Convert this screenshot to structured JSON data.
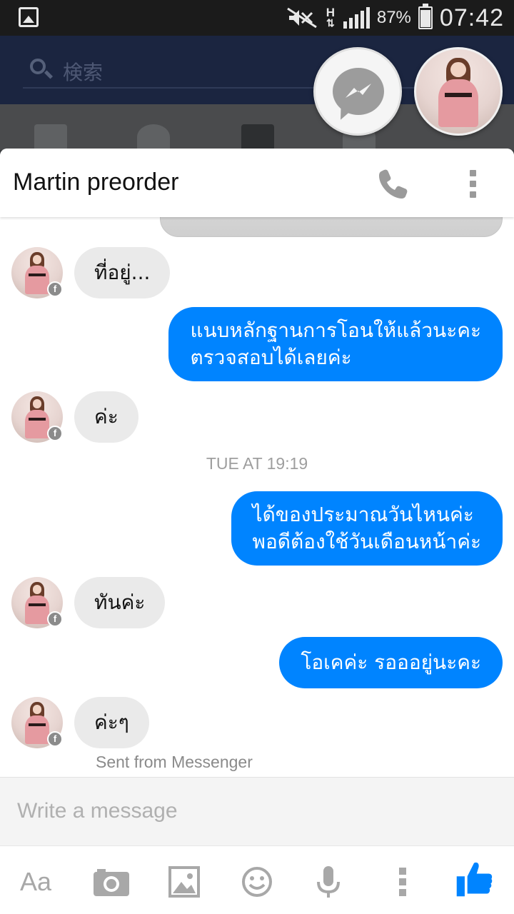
{
  "status_bar": {
    "battery": "87%",
    "time": "07:42",
    "network": "H",
    "icons": [
      "gallery-icon",
      "mute-icon",
      "network-h-icon",
      "signal-icon",
      "battery-icon"
    ]
  },
  "background_app": {
    "search_placeholder": "検索"
  },
  "chat_heads": [
    "messenger-icon",
    "contact-avatar"
  ],
  "conversation": {
    "title": "Martin preorder",
    "actions": [
      "phone-icon",
      "more-icon"
    ],
    "messages": [
      {
        "side": "in",
        "text": "ที่อยู่..."
      },
      {
        "side": "out",
        "lines": [
          "แนบหลักฐานการโอนให้แล้วนะคะ",
          "ตรวจสอบได้เลยค่ะ"
        ]
      },
      {
        "side": "in",
        "text": "ค่ะ"
      },
      {
        "timestamp": "TUE AT 19:19"
      },
      {
        "side": "out",
        "lines": [
          "ได้ของประมาณวันไหนค่ะ",
          "พอดีต้องใช้วันเดือนหน้าค่ะ"
        ]
      },
      {
        "side": "in",
        "text": "ทันค่ะ"
      },
      {
        "side": "out",
        "text": "โอเคค่ะ รอออยู่นะคะ"
      },
      {
        "side": "in",
        "text": "ค่ะๆ"
      }
    ],
    "sent_from": "Sent from Messenger"
  },
  "composer": {
    "placeholder": "Write a message",
    "tools": {
      "text_style_label": "Aa",
      "icons": [
        "camera-icon",
        "gallery-icon",
        "emoji-icon",
        "microphone-icon",
        "more-icon",
        "like-icon"
      ]
    }
  },
  "colors": {
    "outgoing_bubble": "#0084ff",
    "incoming_bubble": "#eaeaea",
    "like_button": "#0084ff"
  }
}
